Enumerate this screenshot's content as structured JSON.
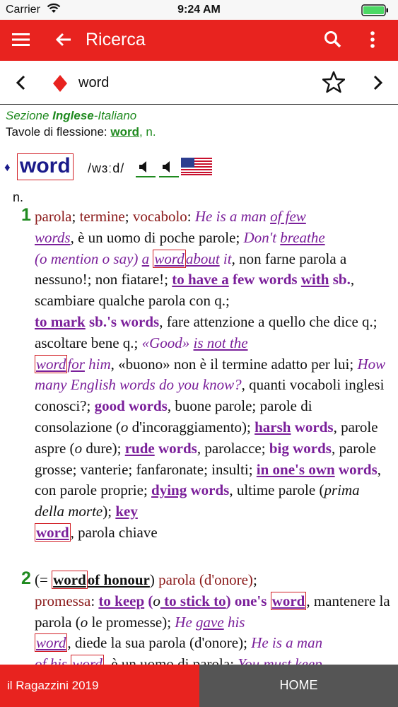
{
  "status": {
    "carrier": "Carrier",
    "time": "9:24 AM"
  },
  "appbar": {
    "title": "Ricerca"
  },
  "wordbar": {
    "word": "word"
  },
  "entry": {
    "sezione_prefix": "Sezione ",
    "sezione_bold": "Inglese",
    "sezione_suffix": "-Italiano",
    "tavole_label": "Tavole di flessione: ",
    "tavole_link": "word",
    "tavole_pos": ", n.",
    "headword_mark": "♦",
    "headword": "word",
    "ipa": "/wɜːd/",
    "pos": "n.",
    "sense1_number": "1",
    "sense2_number": "2"
  },
  "sense1": {
    "t1": "parola",
    "s1": "; ",
    "t2": "termine",
    "s2": "; ",
    "t3": "vocabolo",
    "s3": ": ",
    "e1": "He is a man ",
    "e1u": "of few",
    "e2": "words",
    "p1": ", è un uomo di poche parole",
    "s4": "; ",
    "e3": "Don't ",
    "e3u": "breathe",
    "e4a": "(",
    "e4": "o mention o say",
    "e4b": ") ",
    "e5": "a",
    "e5w": "word",
    "e5u": "about",
    "e5b": " it",
    "p2": ", non farne parola a nessuno!",
    "s5": "; ",
    "p3": "non fiatare!",
    "s6": "; ",
    "ph1a": "to have a",
    "ph1b": " few words ",
    "ph1c": "with",
    "ph1d": " sb.",
    "p4": ", scambiare qualche parola con q.",
    "s7": "; ",
    "ph2a": "to mark",
    "ph2b": " sb.'s words",
    "p5": ", fare attenzione a quello che dice q.",
    "s8": "; ",
    "p6": "ascoltare bene q.",
    "s9": "; ",
    "e6": "«Good» ",
    "e6u": "is not the",
    "e7w": "word",
    "e7u": "for",
    "e7b": " him",
    "p7": ", «buono» non è il termine adatto per lui",
    "s10": "; ",
    "e8": "How many English words do you know?",
    "p8": ", quanti vocaboli inglesi conosci?",
    "s11": "; ",
    "ph3": "good words",
    "p9": ", buone parole",
    "s12": "; ",
    "p10": "parole di consolazione (",
    "p10o": "o",
    "p10b": " d'incoraggiamento)",
    "s13": "; ",
    "ph4a": "harsh",
    "ph4b": " words",
    "p11": ", parole aspre (",
    "p11o": "o",
    "p11b": " dure)",
    "s14": "; ",
    "ph5a": "rude",
    "ph5b": " words",
    "p12": ", parolacce",
    "s15": "; ",
    "ph6": "big words",
    "p13": ", parole grosse",
    "s16": "; ",
    "p14": "vanterie",
    "s17": "; ",
    "p15": "fanfaronate",
    "s18": "; ",
    "p16": "insulti",
    "s19": "; ",
    "ph7a": "in one's own",
    "ph7b": " words",
    "p17": ", con parole proprie",
    "s20": "; ",
    "ph8a": "dying",
    "ph8b": " words",
    "p18": ", ultime parole (",
    "p18i": "prima della morte",
    "p18b": ")",
    "s21": "; ",
    "ph9a": "key",
    "ph9w": "word",
    "p19": ", parola chiave"
  },
  "sense2": {
    "o1": "(= ",
    "w1": "word",
    "w1u": "of honour",
    "o2": ") ",
    "t1": "parola (d'onore)",
    "s1": "; ",
    "t2": "promessa",
    "s2": ": ",
    "ph1a": "to keep",
    "ph1b": " (",
    "ph1o": "o",
    "ph1c": " to stick to",
    "ph1d": ") one's ",
    "ph1w": "word",
    "p1": ", mantenere la parola (",
    "p1o": "o",
    "p1b": " le promesse)",
    "s3": "; ",
    "e1": "He ",
    "e1u": "gave",
    "e1b": " his",
    "e2w": "word",
    "p2": ", diede la sua parola (d'onore)",
    "s4": "; ",
    "e3": "He is a man",
    "e4": "of his ",
    "e4w": "word",
    "p3": ", è un uomo di parola",
    "s5": "; ",
    "e5": "You must keep"
  },
  "bottom": {
    "left_label": "il Ragazzini 2019",
    "right_label": "HOME"
  },
  "colors": {
    "accent": "#e8231f",
    "sense_number": "#1f8a1f",
    "example": "#7a1f9a",
    "translation": "#8b1a1a",
    "box": "#d21f26"
  }
}
